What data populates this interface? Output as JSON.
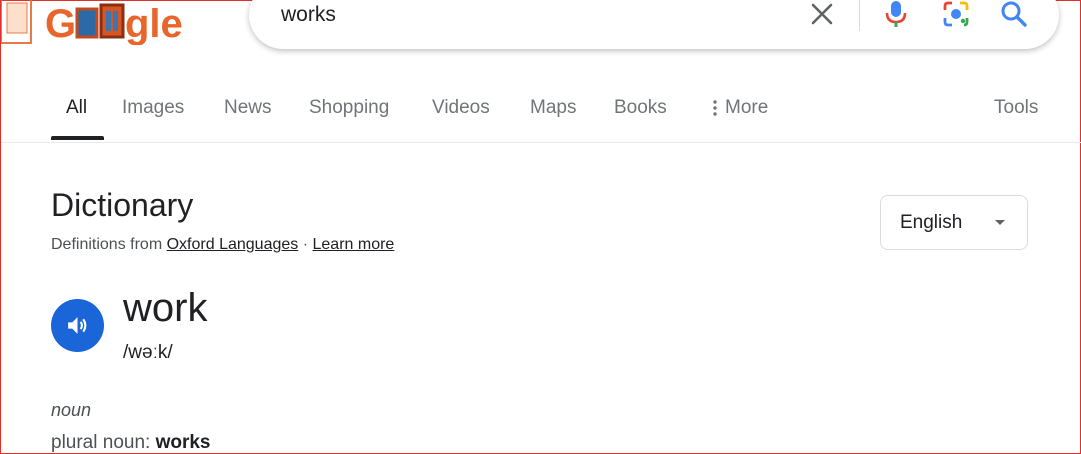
{
  "logo": {
    "text": "Google"
  },
  "search": {
    "query": "works"
  },
  "tabs": [
    {
      "label": "All"
    },
    {
      "label": "Images"
    },
    {
      "label": "News"
    },
    {
      "label": "Shopping"
    },
    {
      "label": "Videos"
    },
    {
      "label": "Maps"
    },
    {
      "label": "Books"
    },
    {
      "label": "More"
    }
  ],
  "tools_label": "Tools",
  "dictionary": {
    "title": "Dictionary",
    "source_prefix": "Definitions from",
    "source_link": "Oxford Languages",
    "separator": "·",
    "learn_more": "Learn more",
    "language": "English",
    "word": "work",
    "phonetic": "/wəːk/",
    "part_of_speech": "noun",
    "plural_label": "plural noun:",
    "plural_value": "works"
  },
  "colors": {
    "accent": "#1a66d8",
    "tab_inactive": "#70757a",
    "text": "#202124"
  },
  "icons": [
    "clear-icon",
    "microphone-icon",
    "lens-camera-icon",
    "search-icon",
    "more-vert-icon",
    "dropdown-caret-icon",
    "speaker-icon"
  ]
}
